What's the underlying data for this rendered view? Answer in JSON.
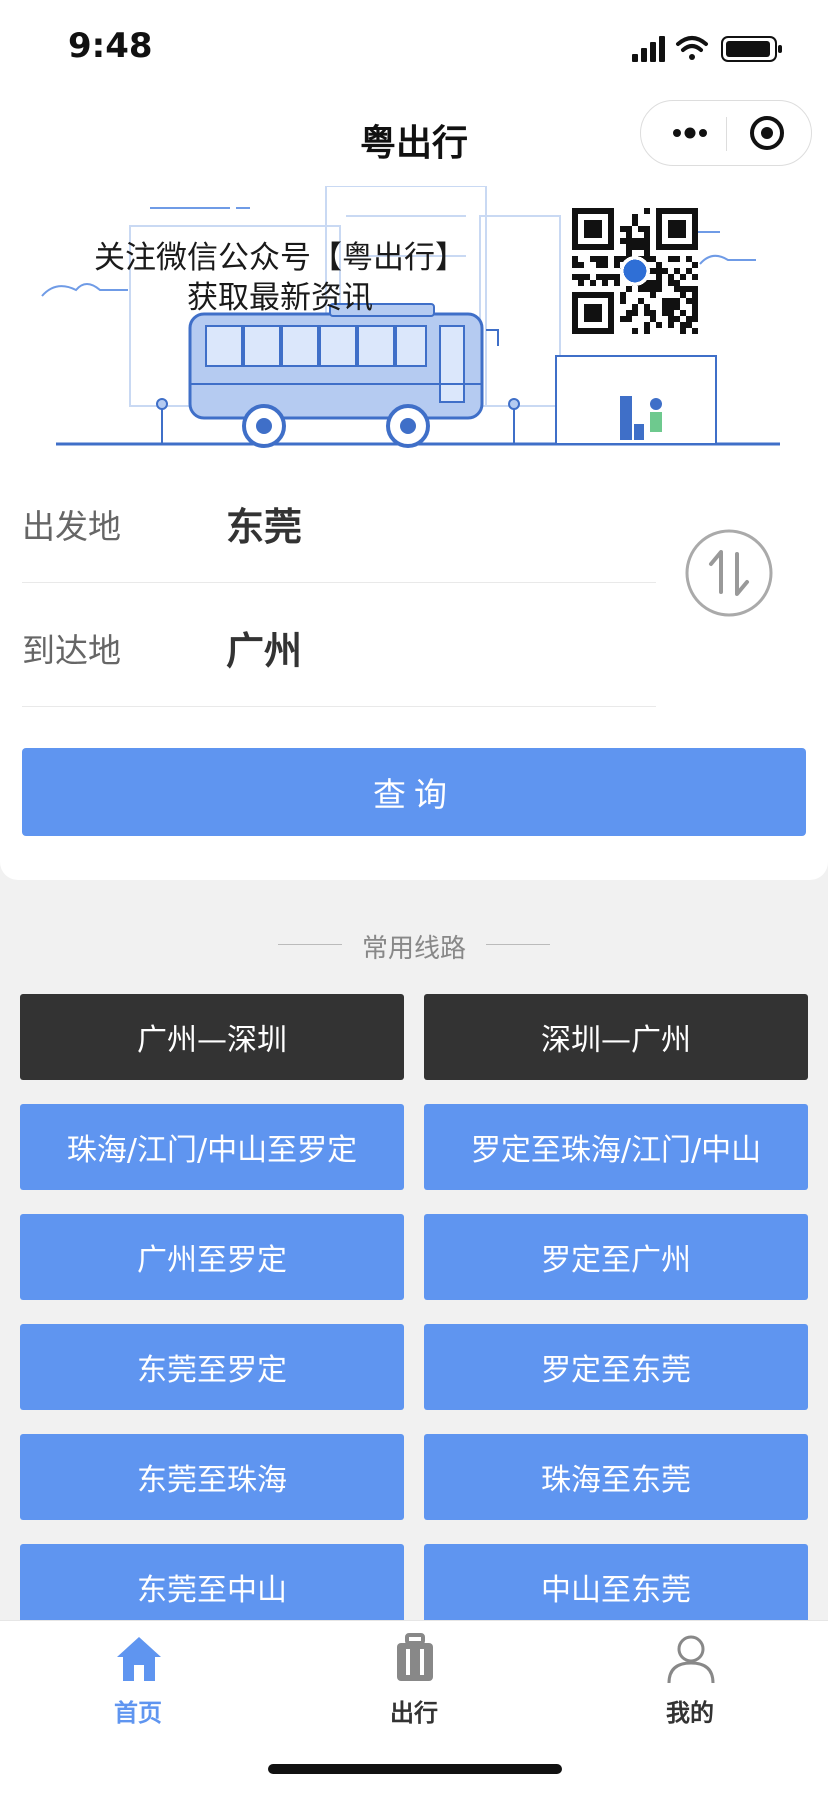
{
  "status_bar": {
    "time": "9:48"
  },
  "nav": {
    "title": "粤出行"
  },
  "banner": {
    "line1": "关注微信公众号【粤出行】",
    "line2": "获取最新资讯"
  },
  "search": {
    "from_label": "出发地",
    "from_value": "东莞",
    "to_label": "到达地",
    "to_value": "广州",
    "query_button": "查询"
  },
  "routes": {
    "header": "常用线路",
    "items": [
      {
        "label": "广州—深圳",
        "style": "dark"
      },
      {
        "label": "深圳—广州",
        "style": "dark"
      },
      {
        "label": "珠海/江门/中山至罗定",
        "style": "blue"
      },
      {
        "label": "罗定至珠海/江门/中山",
        "style": "blue"
      },
      {
        "label": "广州至罗定",
        "style": "blue"
      },
      {
        "label": "罗定至广州",
        "style": "blue"
      },
      {
        "label": "东莞至罗定",
        "style": "blue"
      },
      {
        "label": "罗定至东莞",
        "style": "blue"
      },
      {
        "label": "东莞至珠海",
        "style": "blue"
      },
      {
        "label": "珠海至东莞",
        "style": "blue"
      },
      {
        "label": "东莞至中山",
        "style": "blue"
      },
      {
        "label": "中山至东莞",
        "style": "blue"
      }
    ]
  },
  "tabs": [
    {
      "label": "首页",
      "icon": "home-icon",
      "active": true
    },
    {
      "label": "出行",
      "icon": "luggage-icon",
      "active": false
    },
    {
      "label": "我的",
      "icon": "user-icon",
      "active": false
    }
  ],
  "colors": {
    "accent": "#5f95f0",
    "dark_button": "#333333"
  }
}
